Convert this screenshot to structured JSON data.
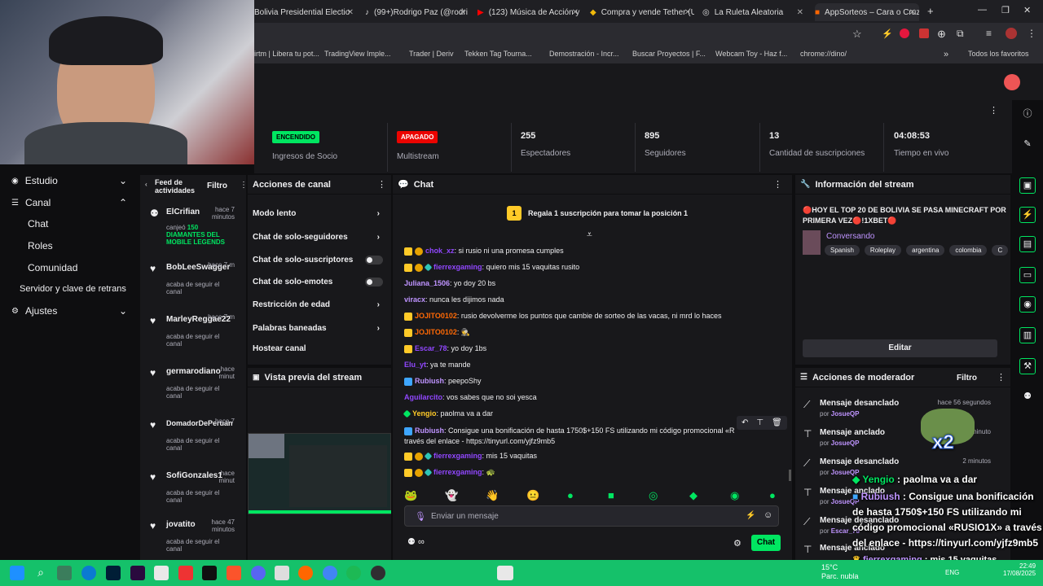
{
  "browser": {
    "tabs": [
      {
        "title": "Bolivia Presidential Electio"
      },
      {
        "title": "(99+)Rodrigo Paz (@rodri"
      },
      {
        "title": "(123) Música de Acción y"
      },
      {
        "title": "Compra y vende Tether (U"
      },
      {
        "title": "La Ruleta Aleatoria"
      },
      {
        "title": "AppSorteos – Cara o Cruz"
      }
    ],
    "bookmarks": [
      "irtm | Libera tu pot...",
      "TradingView Imple...",
      "Trader | Deriv",
      "Tekken Tag Tourna...",
      "Demostración - Incr...",
      "Buscar Proyectos | F...",
      "Webcam Toy - Haz f...",
      "chrome://dino/"
    ],
    "bookmarks_all": "Todos los favoritos"
  },
  "leftnav": {
    "items": [
      {
        "label": "Estudio"
      },
      {
        "label": "Canal"
      },
      {
        "label": "Chat"
      },
      {
        "label": "Roles"
      },
      {
        "label": "Comunidad"
      },
      {
        "label": "Servidor y clave de retrans"
      },
      {
        "label": "Ajustes"
      }
    ]
  },
  "stats": {
    "partner_badge": "ENCENDIDO",
    "partner_label": "Ingresos de Socio",
    "multistream_badge": "APAGADO",
    "multistream_label": "Multistream",
    "viewers": "255",
    "viewers_label": "Espectadores",
    "followers": "895",
    "followers_label": "Seguidores",
    "subs": "13",
    "subs_label": "Cantidad de suscripciones",
    "uptime": "04:08:53",
    "uptime_label": "Tiempo en vivo"
  },
  "feed": {
    "title": "Feed de actividades",
    "filter": "Filtro",
    "items": [
      {
        "name": "ElCrifian",
        "time": "hace 7 minutos",
        "desc": "canjeó ",
        "highlight": "150 DIAMANTES DEL MOBILE LEGENDS"
      },
      {
        "name": "BobLeeSwagger",
        "time": "hace 7 m",
        "desc": "acaba de seguir el canal"
      },
      {
        "name": "MarleyReggae22",
        "time": "hace 7 m",
        "desc": "acaba de seguir el canal"
      },
      {
        "name": "germarodiano",
        "time": "hace minut",
        "desc": "acaba de seguir el canal"
      },
      {
        "name": "DomadorDePeruan",
        "time": "hace 7",
        "desc": "acaba de seguir el canal"
      },
      {
        "name": "SofiGonzales1",
        "time": "hace minut",
        "desc": "acaba de seguir el canal"
      },
      {
        "name": "jovatito",
        "time": "hace 47 minutos",
        "desc": "acaba de seguir el canal"
      }
    ]
  },
  "actions": {
    "title": "Acciones de canal",
    "items": [
      {
        "label": "Modo lento"
      },
      {
        "label": "Chat de solo-seguidores"
      },
      {
        "label": "Chat de solo-suscriptores"
      },
      {
        "label": "Chat de solo-emotes"
      },
      {
        "label": "Restricción de edad"
      },
      {
        "label": "Palabras baneadas"
      },
      {
        "label": "Hostear canal"
      }
    ],
    "preview_title": "Vista previa del stream"
  },
  "chat": {
    "title": "Chat",
    "gift_text": "Regala 1 suscripción para tomar la posición 1",
    "gift_rank": "1",
    "messages": [
      {
        "user": "chok_xz",
        "color": "#9147ff",
        "text": ": si rusio ni una promesa cumples"
      },
      {
        "user": "fierrexgaming",
        "color": "#9147ff",
        "text": ": quiero mis 15 vaquitas rusito"
      },
      {
        "user": "Juliana_1506",
        "color": "#bf94ff",
        "text": ": yo doy 20 bs"
      },
      {
        "user": "viracx",
        "color": "#bf94ff",
        "text": ": nunca les dijimos nada"
      },
      {
        "user": "JOJITO0102",
        "color": "#ff6905",
        "text": ": rusio devolverme los puntos que cambie de sorteo de las vacas, ni mrd lo haces"
      },
      {
        "user": "JOJITO0102",
        "color": "#ff6905",
        "text": ": 🕵"
      },
      {
        "user": "Escar_78",
        "color": "#9147ff",
        "text": ": yo doy 1bs"
      },
      {
        "user": "Elu_yt",
        "color": "#9147ff",
        "text": ": ya te mande"
      },
      {
        "user": "Rubiush",
        "color": "#bf94ff",
        "text": ": peepoShy"
      },
      {
        "user": "Aguilarcito",
        "color": "#9147ff",
        "text": ": vos sabes que no soi yesca"
      },
      {
        "user": "Yengio",
        "color": "#ffca28",
        "text": ": paolma va a dar"
      },
      {
        "user": "Rubiush",
        "color": "#bf94ff",
        "text": ": Consigue una bonificación de hasta 1750$+150 FS utilizando mi código promocional «R",
        "text2": "través del enlace - https://tinyurl.com/yjfz9mb5"
      },
      {
        "user": "fierrexgaming",
        "color": "#9147ff",
        "text": ": mis 15 vaquitas"
      },
      {
        "user": "fierrexgaming",
        "color": "#9147ff",
        "text": ": 🐢"
      }
    ],
    "input_placeholder": "Enviar un mensaje",
    "send_label": "Chat",
    "points": "∞"
  },
  "stream_info": {
    "title": "Información del stream",
    "stream_title": "🔴HOY EL TOP 20 DE BOLIVIA SE PASA MINECRAFT POR PRIMERA VEZ🔴!1XBET🔴",
    "category": "Conversando",
    "tags": [
      "Spanish",
      "Roleplay",
      "argentina",
      "colombia",
      "C"
    ],
    "edit_label": "Editar"
  },
  "mod_actions": {
    "title": "Acciones de moderador",
    "filter": "Filtro",
    "items": [
      {
        "title": "Mensaje desanclado",
        "by": "JosueQP",
        "time": "hace 56 segundos"
      },
      {
        "title": "Mensaje anclado",
        "by": "JosueQP",
        "time": "minuto"
      },
      {
        "title": "Mensaje desanclado",
        "by": "JosueQP",
        "time": "2 minutos"
      },
      {
        "title": "Mensaje anclado",
        "by": "JosueQP",
        "time": ""
      },
      {
        "title": "Mensaje desanclado",
        "by": "Escar_78",
        "time": ""
      },
      {
        "title": "Mensaje anclado",
        "by": "",
        "time": ""
      }
    ]
  },
  "overlay": {
    "line1_user": "Yengio",
    "line1_text": " : paolma va a dar",
    "line2_user": "Rubiush",
    "line2_text": " : Consigue una bonificación",
    "line3": "de hasta 1750$+150 FS utilizando mi",
    "line4": "código promocional «RUSIO1X» a través",
    "line5": "del enlace - https://tinyurl.com/yjfz9mb5",
    "line6_user": "fierrexgaming",
    "line6_text": " : mis 15 vaquitas",
    "line7_user": "fierrexgaming",
    "x2": "x2"
  },
  "taskbar": {
    "weather_temp": "15°C",
    "weather_desc": "Parc. nubla",
    "lang": "ENG",
    "time": "22:49",
    "date": "17/08/2025"
  },
  "colors": {
    "accent": "#9147ff",
    "on": "#00e661",
    "off": "#eb0400",
    "bg": "#18181b",
    "taskbar": "#15c16a"
  }
}
